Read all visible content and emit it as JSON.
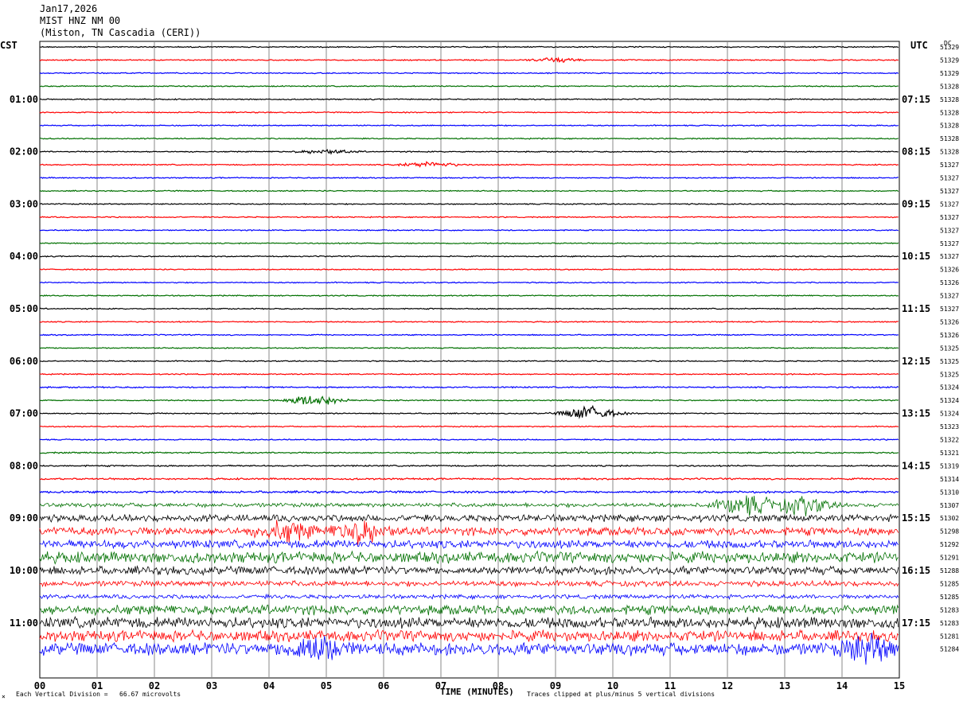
{
  "header": {
    "date": "Jan17,2026",
    "station": "MIST HNZ NM 00",
    "location": "(Miston, TN Cascadia (CERI))"
  },
  "left_axis_label": "CST",
  "right_axis_label": "UTC",
  "dc_label": "DC",
  "footer": {
    "scale_note": "Each Vertical Division =   66.67 microvolts",
    "xlabel": "TIME (MINUTES)",
    "clip_note": "Traces clipped at plus/minus 5 vertical divisions",
    "corner_mark": "×"
  },
  "colors": {
    "trace_cycle": [
      "#000000",
      "#ff0000",
      "#0000ff",
      "#007000"
    ],
    "grid": "#888888"
  },
  "chart_data": {
    "type": "line",
    "title": "MIST HNZ NM 00",
    "xlabel": "TIME (MINUTES)",
    "x_ticks": [
      "00",
      "01",
      "02",
      "03",
      "04",
      "05",
      "06",
      "07",
      "08",
      "09",
      "10",
      "11",
      "12",
      "13",
      "14",
      "15"
    ],
    "xlim": [
      0,
      15
    ],
    "left_time_labels": [
      "01:00",
      "02:00",
      "03:00",
      "04:00",
      "05:00",
      "06:00",
      "07:00",
      "08:00",
      "09:00",
      "10:00",
      "11:00"
    ],
    "right_time_labels": [
      "07:15",
      "08:15",
      "09:15",
      "10:15",
      "11:15",
      "12:15",
      "13:15",
      "14:15",
      "15:15",
      "16:15",
      "17:15"
    ],
    "dc_values": [
      "51329",
      "51329",
      "51329",
      "51328",
      "51328",
      "51328",
      "51328",
      "51328",
      "51328",
      "51327",
      "51327",
      "51327",
      "51327",
      "51327",
      "51327",
      "51327",
      "51327",
      "51326",
      "51326",
      "51327",
      "51327",
      "51326",
      "51326",
      "51325",
      "51325",
      "51325",
      "51324",
      "51324",
      "51324",
      "51323",
      "51322",
      "51321",
      "51319",
      "51314",
      "51310",
      "51307",
      "51302",
      "51298",
      "51292",
      "51291",
      "51288",
      "51285",
      "51285",
      "51283",
      "51283",
      "51281",
      "51284"
    ],
    "trace_amplitudes": [
      0.8,
      0.8,
      0.8,
      0.8,
      0.8,
      0.8,
      0.8,
      0.8,
      0.8,
      0.8,
      0.8,
      0.8,
      0.8,
      0.8,
      0.8,
      0.8,
      0.8,
      0.8,
      0.8,
      0.8,
      0.8,
      0.8,
      0.8,
      0.8,
      0.8,
      0.8,
      1,
      0.8,
      0.8,
      0.8,
      0.8,
      1,
      1,
      1.2,
      1.5,
      3,
      5,
      6,
      6,
      8,
      6,
      4,
      3,
      7,
      8,
      8,
      9
    ],
    "events": [
      {
        "trace": 1,
        "minute": 9.0,
        "amp": 3
      },
      {
        "trace": 8,
        "minute": 5.0,
        "amp": 3
      },
      {
        "trace": 9,
        "minute": 6.8,
        "amp": 4
      },
      {
        "trace": 27,
        "minute": 4.8,
        "amp": 8
      },
      {
        "trace": 28,
        "minute": 9.6,
        "amp": 10
      },
      {
        "trace": 35,
        "minute": 12.3,
        "amp": 14
      },
      {
        "trace": 35,
        "minute": 13.3,
        "amp": 12
      },
      {
        "trace": 37,
        "minute": 4.3,
        "amp": 12
      },
      {
        "trace": 37,
        "minute": 5.6,
        "amp": 14
      },
      {
        "trace": 46,
        "minute": 4.8,
        "amp": 18
      },
      {
        "trace": 46,
        "minute": 14.5,
        "amp": 16
      }
    ]
  }
}
